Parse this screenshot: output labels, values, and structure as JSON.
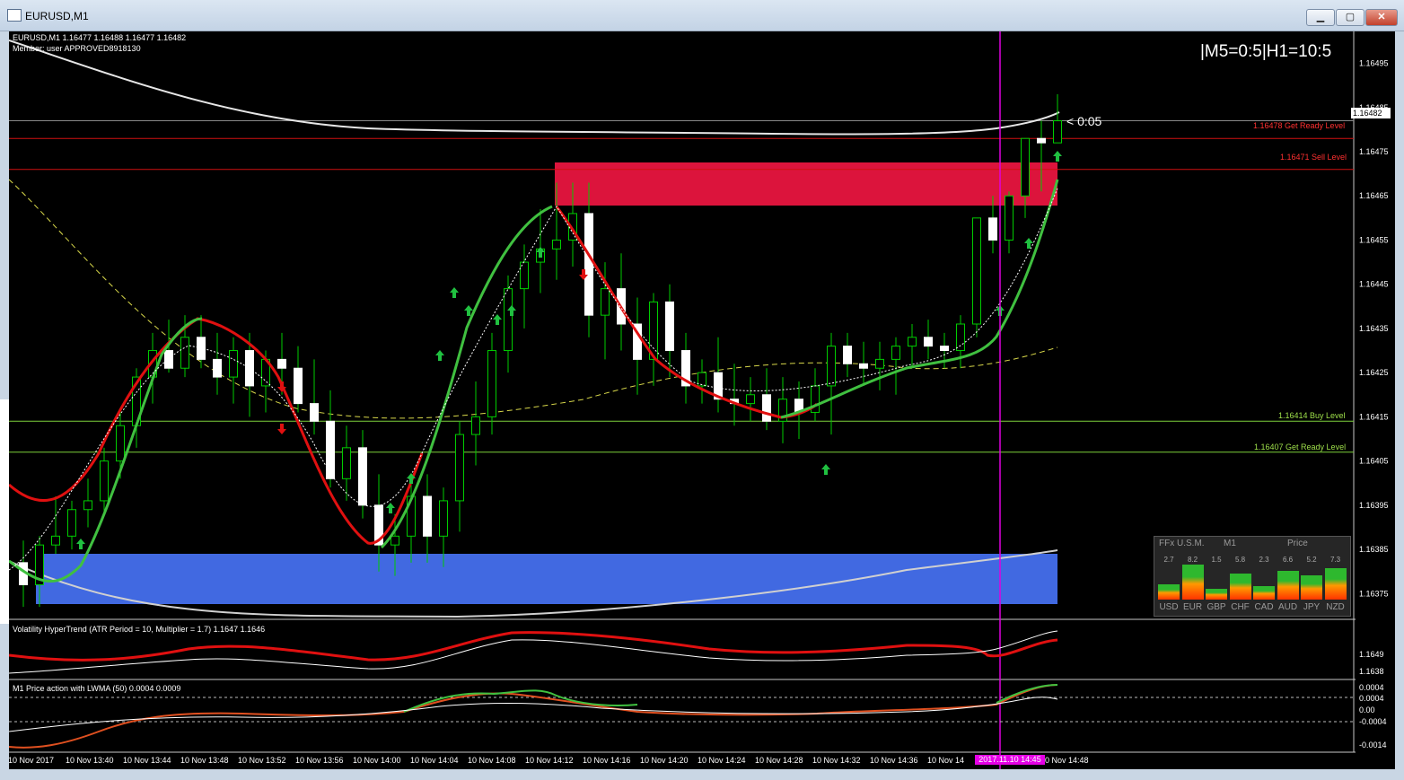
{
  "window": {
    "title": "EURUSD,M1",
    "buttons": {
      "minimize": "▁",
      "restore": "▢",
      "close": "✕"
    }
  },
  "chart_header": {
    "symbol_line": "EURUSD,M1  1.16477 1.16488 1.16477 1.16482",
    "member_line": "Member:  user   APPROVED8918130",
    "timeframe_status": "|M5=0:5|H1=10:5",
    "countdown": "< 0:05",
    "current_price": "1.16482"
  },
  "colors": {
    "bull": "#ffffff",
    "bear": "#ffffff",
    "wick": "#00cc00",
    "sell_zone": "#dc143c",
    "buy_zone": "#4169e1",
    "signal_line": "#e000e0",
    "ma_red": "#e01010",
    "ma_green": "#40c040"
  },
  "levels": [
    {
      "label": "1.16478 Get Ready Level",
      "price": 1.16478,
      "color": "#d01010"
    },
    {
      "label": "1.16471 Sell Level",
      "price": 1.16471,
      "color": "#d01010"
    },
    {
      "label": "1.16414 Buy Level",
      "price": 1.16414,
      "color": "#7cd03a"
    },
    {
      "label": "1.16407 Get Ready Level",
      "price": 1.16407,
      "color": "#7cd03a"
    }
  ],
  "chart_data": {
    "type": "candlestick",
    "ylim": [
      1.16371,
      1.16501
    ],
    "y_ticks": [
      "1.16495",
      "1.16485",
      "1.16475",
      "1.16465",
      "1.16455",
      "1.16445",
      "1.16435",
      "1.16425",
      "1.16415",
      "1.16405",
      "1.16395",
      "1.16385",
      "1.16375"
    ],
    "x_ticks": [
      "10 Nov 2017",
      "10 Nov 13:40",
      "10 Nov 13:44",
      "10 Nov 13:48",
      "10 Nov 13:52",
      "10 Nov 13:56",
      "10 Nov 14:00",
      "10 Nov 14:04",
      "10 Nov 14:08",
      "10 Nov 14:12",
      "10 Nov 14:16",
      "10 Nov 14:20",
      "10 Nov 14:24",
      "10 Nov 14:28",
      "10 Nov 14:32",
      "10 Nov 14:36",
      "10 Nov 14",
      "10 Nov 14:48"
    ],
    "signal_time": "2017.11.10 14:45",
    "sell_zone": {
      "from": 1.16462,
      "to": 1.16472,
      "start": "14:12"
    },
    "buy_zone": {
      "from": 1.16373,
      "to": 1.16385
    },
    "candles": [
      [
        1.16382,
        1.16387,
        1.16372,
        1.16377
      ],
      [
        1.16377,
        1.16388,
        1.16372,
        1.16386
      ],
      [
        1.16386,
        1.16397,
        1.16384,
        1.16388
      ],
      [
        1.16388,
        1.16396,
        1.16385,
        1.16394
      ],
      [
        1.16394,
        1.16401,
        1.1639,
        1.16396
      ],
      [
        1.16396,
        1.16408,
        1.16393,
        1.16405
      ],
      [
        1.16405,
        1.16417,
        1.16401,
        1.16413
      ],
      [
        1.16413,
        1.16426,
        1.16408,
        1.16424
      ],
      [
        1.16424,
        1.16434,
        1.16418,
        1.1643
      ],
      [
        1.1643,
        1.16437,
        1.16425,
        1.16426
      ],
      [
        1.16426,
        1.16438,
        1.16424,
        1.16433
      ],
      [
        1.16433,
        1.16438,
        1.16426,
        1.16428
      ],
      [
        1.16428,
        1.16434,
        1.1642,
        1.16424
      ],
      [
        1.16424,
        1.16433,
        1.16418,
        1.1643
      ],
      [
        1.1643,
        1.16434,
        1.16415,
        1.16422
      ],
      [
        1.16422,
        1.1643,
        1.16416,
        1.16428
      ],
      [
        1.16428,
        1.16434,
        1.1642,
        1.16426
      ],
      [
        1.16426,
        1.16431,
        1.16416,
        1.16418
      ],
      [
        1.16418,
        1.16428,
        1.16411,
        1.16414
      ],
      [
        1.16414,
        1.16421,
        1.16399,
        1.16401
      ],
      [
        1.16401,
        1.16413,
        1.16396,
        1.16408
      ],
      [
        1.16408,
        1.16412,
        1.16392,
        1.16395
      ],
      [
        1.16395,
        1.16402,
        1.1638,
        1.16386
      ],
      [
        1.16386,
        1.16393,
        1.16379,
        1.16388
      ],
      [
        1.16388,
        1.16402,
        1.16382,
        1.16397
      ],
      [
        1.16397,
        1.16402,
        1.16382,
        1.16388
      ],
      [
        1.16388,
        1.16399,
        1.16381,
        1.16396
      ],
      [
        1.16396,
        1.16414,
        1.16389,
        1.16411
      ],
      [
        1.16411,
        1.16423,
        1.16404,
        1.16415
      ],
      [
        1.16415,
        1.16434,
        1.16411,
        1.1643
      ],
      [
        1.1643,
        1.16447,
        1.16425,
        1.16444
      ],
      [
        1.16444,
        1.16454,
        1.16435,
        1.1645
      ],
      [
        1.1645,
        1.16462,
        1.16443,
        1.16453
      ],
      [
        1.16453,
        1.16468,
        1.16446,
        1.16455
      ],
      [
        1.16455,
        1.16468,
        1.16449,
        1.16461
      ]
    ]
  },
  "indicators": {
    "volatility": {
      "label": "Volatility HyperTrend (ATR Period = 10, Multiplier = 1.7) 1.1647 1.1646",
      "y_ticks": [
        "1.1649",
        "1.1638"
      ]
    },
    "price_action": {
      "label": "M1 Price action with LWMA (50) 0.0004 0.0009",
      "y_ticks": [
        "0.0014",
        "0.0004",
        "0.00",
        "-0.0004",
        "-0.0014"
      ]
    }
  },
  "strength_panel": {
    "headers": [
      "FFx U.S.M.",
      "M1",
      "Price"
    ],
    "currencies": [
      {
        "code": "USD",
        "value": "2.7",
        "strength": 0.27
      },
      {
        "code": "EUR",
        "value": "8.2",
        "strength": 0.82
      },
      {
        "code": "GBP",
        "value": "1.5",
        "strength": 0.15
      },
      {
        "code": "CHF",
        "value": "5.8",
        "strength": 0.58
      },
      {
        "code": "CAD",
        "value": "2.3",
        "strength": 0.23
      },
      {
        "code": "AUD",
        "value": "6.6",
        "strength": 0.66
      },
      {
        "code": "JPY",
        "value": "5.2",
        "strength": 0.52
      },
      {
        "code": "NZD",
        "value": "7.3",
        "strength": 0.73
      }
    ]
  }
}
